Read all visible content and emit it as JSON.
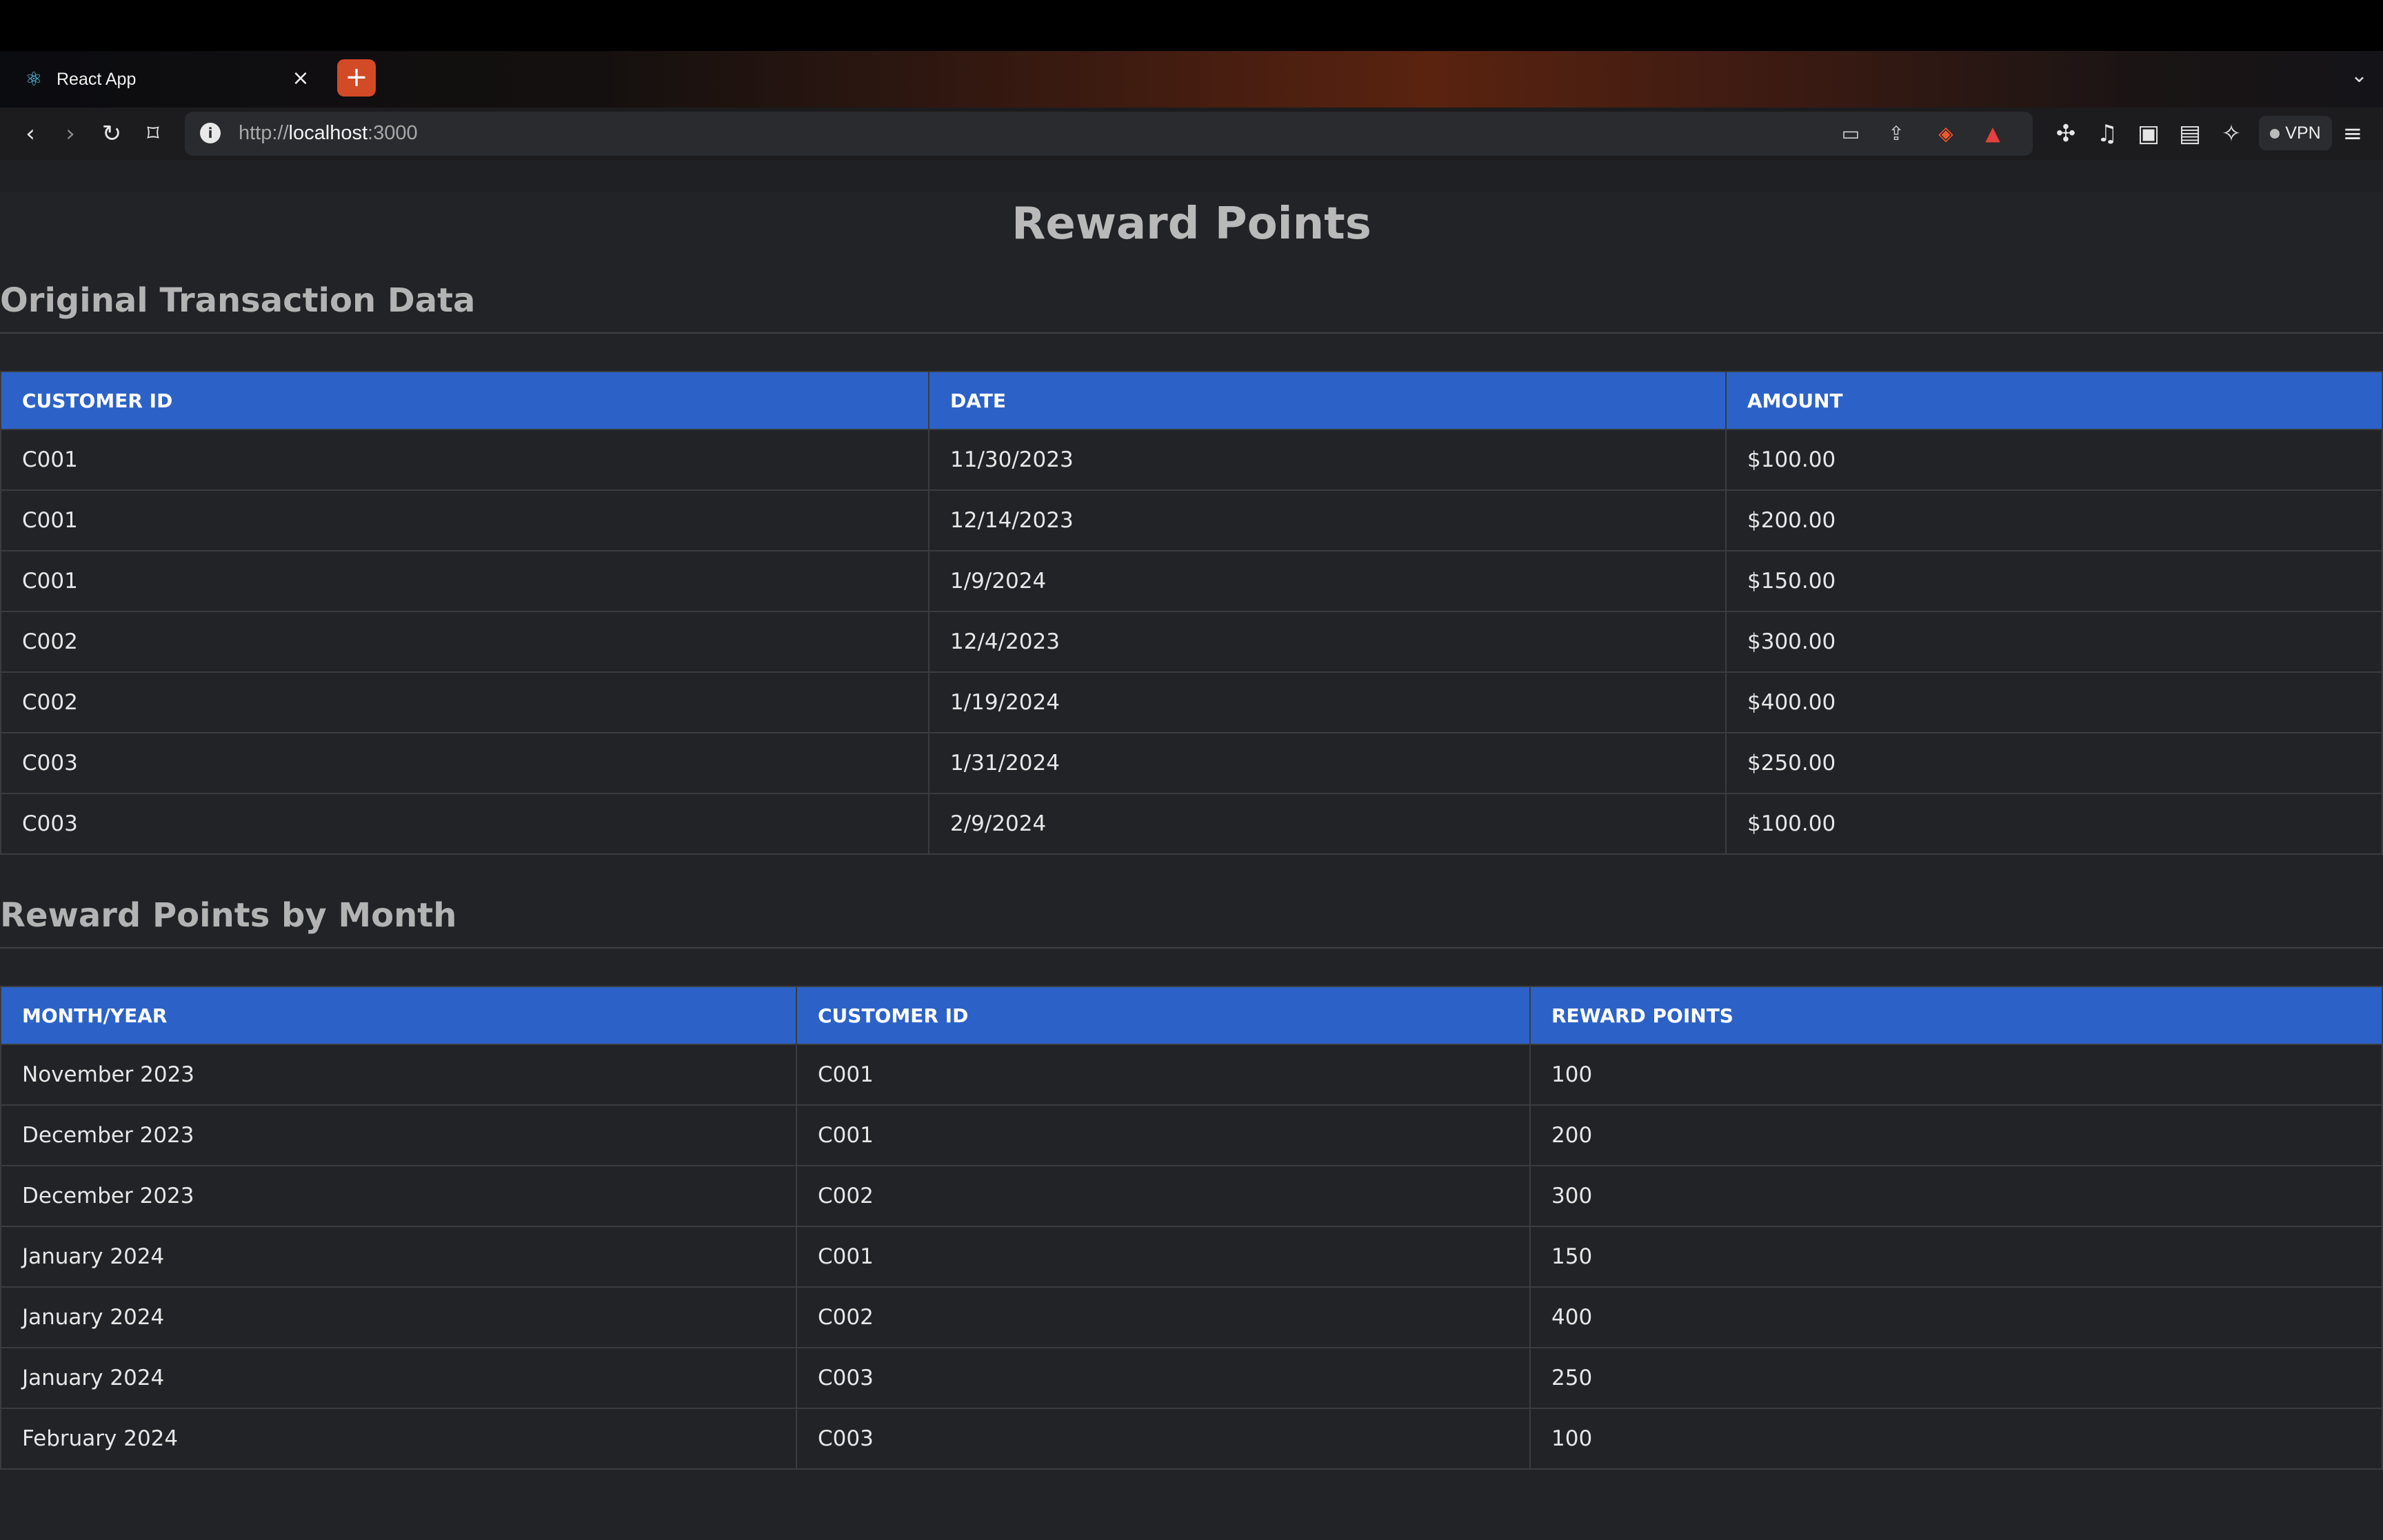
{
  "browser": {
    "tab_title": "React App",
    "new_tab_label": "+",
    "url_scheme": "http://",
    "url_host": "localhost",
    "url_port": ":3000",
    "vpn_label": "VPN"
  },
  "page": {
    "title": "Reward Points",
    "transactions": {
      "heading": "Original Transaction Data",
      "columns": [
        "CUSTOMER ID",
        "DATE",
        "AMOUNT"
      ],
      "rows": [
        [
          "C001",
          "11/30/2023",
          "$100.00"
        ],
        [
          "C001",
          "12/14/2023",
          "$200.00"
        ],
        [
          "C001",
          "1/9/2024",
          "$150.00"
        ],
        [
          "C002",
          "12/4/2023",
          "$300.00"
        ],
        [
          "C002",
          "1/19/2024",
          "$400.00"
        ],
        [
          "C003",
          "1/31/2024",
          "$250.00"
        ],
        [
          "C003",
          "2/9/2024",
          "$100.00"
        ]
      ]
    },
    "rewards": {
      "heading": "Reward Points by Month",
      "columns": [
        "MONTH/YEAR",
        "CUSTOMER ID",
        "REWARD POINTS"
      ],
      "rows": [
        [
          "November 2023",
          "C001",
          "100"
        ],
        [
          "December 2023",
          "C001",
          "200"
        ],
        [
          "December 2023",
          "C002",
          "300"
        ],
        [
          "January 2024",
          "C001",
          "150"
        ],
        [
          "January 2024",
          "C002",
          "400"
        ],
        [
          "January 2024",
          "C003",
          "250"
        ],
        [
          "February 2024",
          "C003",
          "100"
        ]
      ]
    }
  },
  "colors": {
    "header_blue": "#2c62c8",
    "page_bg": "#212326",
    "new_tab_orange": "#d24a26"
  }
}
